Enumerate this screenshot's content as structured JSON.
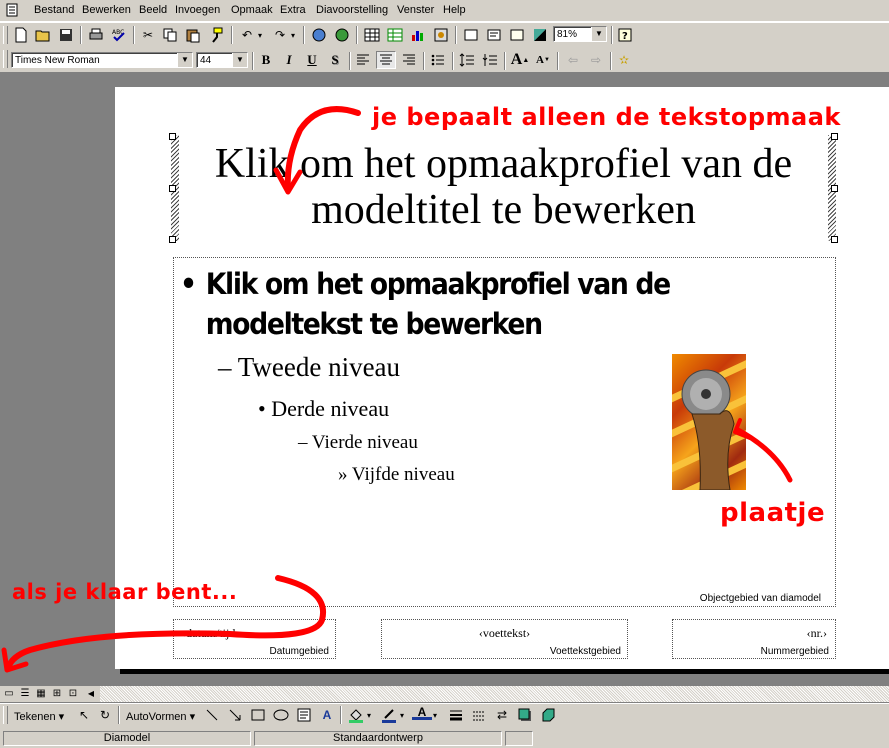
{
  "menu": [
    "Bestand",
    "Bewerken",
    "Beeld",
    "Invoegen",
    "Opmaak",
    "Extra",
    "Diavoorstelling",
    "Venster",
    "Help"
  ],
  "toolbar": {
    "zoom": "81%",
    "font": "Times New Roman",
    "size": "44",
    "bold": "B",
    "italic": "I",
    "underline": "U",
    "shadow": "S"
  },
  "slide": {
    "title": "Klik om het opmaakprofiel van de modeltitel te bewerken",
    "body_l1": "Klik om het opmaakprofiel van de modeltekst te bewerken",
    "body_l2": "– Tweede niveau",
    "body_l3": "• Derde niveau",
    "body_l4": "– Vierde niveau",
    "body_l5": "» Vijfde niveau",
    "body_label": "Objectgebied van diamodel",
    "footer_date_text": "‹datum/tijd›",
    "footer_date_label": "Datumgebied",
    "footer_text": "‹voettekst›",
    "footer_text_label": "Voettekstgebied",
    "footer_num_text": "‹nr.›",
    "footer_num_label": "Nummergebied"
  },
  "annotations": {
    "top": "je bepaalt alleen de tekstopmaak",
    "picture": "plaatje",
    "done": "als je klaar bent..."
  },
  "drawbar": {
    "draw_menu": "Tekenen",
    "autoshapes": "AutoVormen"
  },
  "status": {
    "slide_type": "Diamodel",
    "design": "Standaardontwerp"
  },
  "colors": {
    "annotation": "#ff0000",
    "chrome": "#d4d0c8",
    "workspace": "#808080"
  }
}
